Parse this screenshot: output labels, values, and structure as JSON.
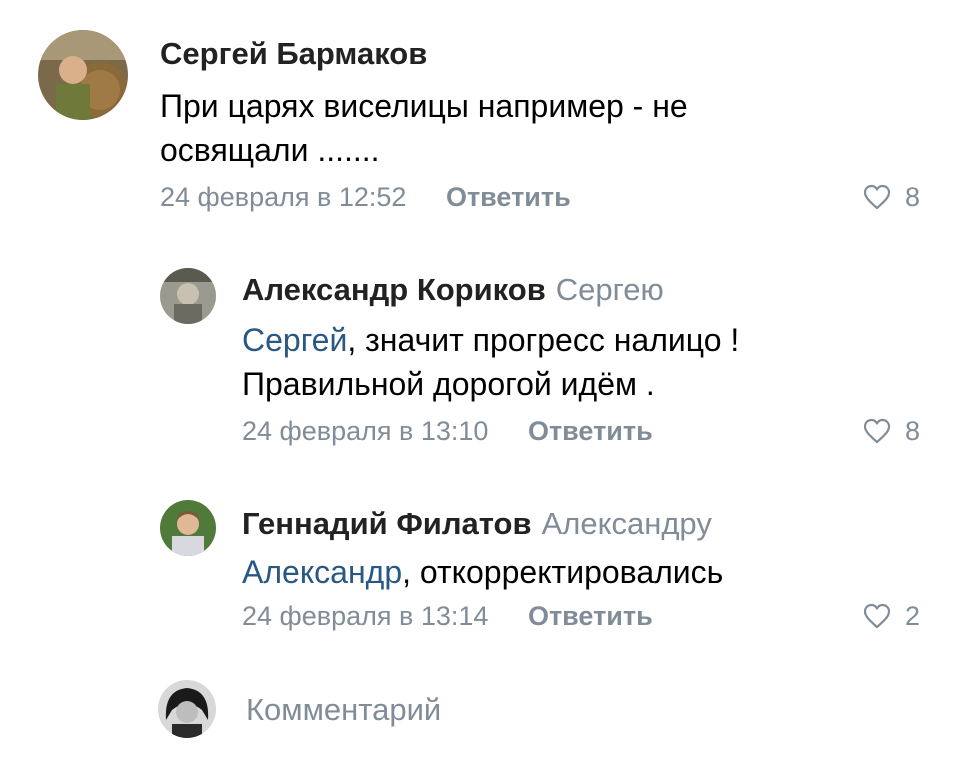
{
  "comments": [
    {
      "author": "Сергей Бармаков",
      "reply_to": "",
      "mention": "",
      "text": "При царях виселицы например - не освящали .......",
      "date": "24 февраля в 12:52",
      "reply_label": "Ответить",
      "likes": "8"
    },
    {
      "author": "Александр Кориков",
      "reply_to": "Сергею",
      "mention": "Сергей",
      "text": ", значит прогресс налицо ! Правильной дорогой идём .",
      "date": "24 февраля в 13:10",
      "reply_label": "Ответить",
      "likes": "8"
    },
    {
      "author": "Геннадий Филатов",
      "reply_to": "Александру",
      "mention": "Александр",
      "text": ", откорректировались",
      "date": "24 февраля в 13:14",
      "reply_label": "Ответить",
      "likes": "2"
    }
  ],
  "composer": {
    "placeholder": "Комментарий"
  },
  "colors": {
    "link": "#2a5885",
    "muted": "#818c99",
    "author": "#222222"
  },
  "icons": {
    "like": "heart-outline-icon"
  }
}
